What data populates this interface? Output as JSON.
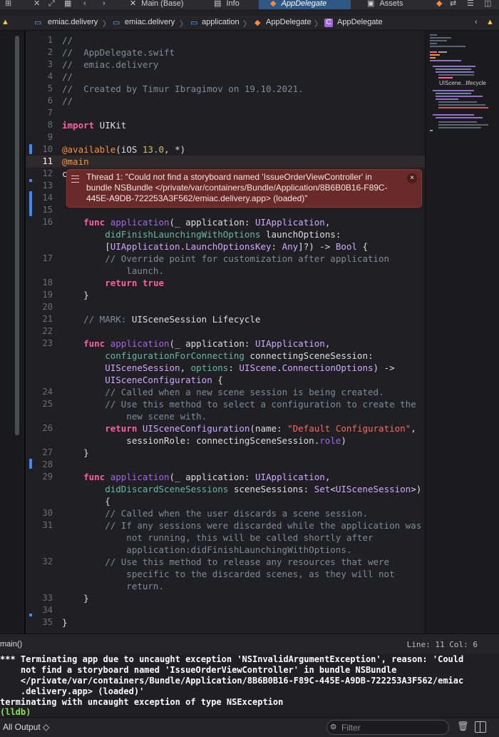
{
  "tabs": [
    {
      "label": "Main (Base)",
      "icon": "close-x-icon"
    },
    {
      "label": "Info",
      "icon": "table-icon"
    },
    {
      "label": "AppDelegate",
      "icon": "swift-icon",
      "active": true
    },
    {
      "label": "Assets",
      "icon": "image-icon"
    }
  ],
  "breadcrumb": [
    "emiac.delivery",
    "emiac.delivery",
    "application",
    "AppDelegate",
    "AppDelegate"
  ],
  "breadcrumb_class_badge": "C",
  "code": {
    "current_line": 11,
    "lines": [
      {
        "n": "1",
        "html": "<span class=\"cm\">//</span>"
      },
      {
        "n": "2",
        "html": "<span class=\"cm\">//  AppDelegate.swift</span>"
      },
      {
        "n": "3",
        "html": "<span class=\"cm\">//  emiac.delivery</span>"
      },
      {
        "n": "4",
        "html": "<span class=\"cm\">//</span>"
      },
      {
        "n": "5",
        "html": "<span class=\"cm\">//  Created by Timur Ibragimov on 19.10.2021.</span>"
      },
      {
        "n": "6",
        "html": "<span class=\"cm\">//</span>"
      },
      {
        "n": "7",
        "html": ""
      },
      {
        "n": "8",
        "html": "<span class=\"kw\">import</span> UIKit"
      },
      {
        "n": "9",
        "html": ""
      },
      {
        "n": "10",
        "html": "<span class=\"at\">@available</span>(iOS <span class=\"nm\">13.0</span>, *)"
      },
      {
        "n": "11",
        "html": "<span class=\"at\">@main</span>"
      },
      {
        "n": "12",
        "html": "c"
      },
      {
        "n": "13",
        "html": ""
      },
      {
        "n": "14",
        "html": ""
      },
      {
        "n": "15",
        "html": ""
      },
      {
        "n": "16",
        "html": "    <span class=\"kw\">func</span> <span class=\"fn\">application</span>(_ application: <span class=\"ty\">UIApplication</span>,\n        <span class=\"pl\">didFinishLaunchingWithOptions</span> launchOptions:\n        [<span class=\"ty\">UIApplication</span>.<span class=\"ty\">LaunchOptionsKey</span>: <span class=\"ty\">Any</span>]?) -> <span class=\"ty\">Bool</span> {"
      },
      {
        "n": "17",
        "html": "        <span class=\"cm\">// Override point for customization after application\n            launch.</span>"
      },
      {
        "n": "18",
        "html": "        <span class=\"kw\">return</span> <span class=\"kw\">true</span>"
      },
      {
        "n": "19",
        "html": "    }"
      },
      {
        "n": "20",
        "html": ""
      },
      {
        "n": "21",
        "html": "    <span class=\"cm\">// MARK: </span><span style=\"color:#dfdfe0\">UISceneSession Lifecycle</span>"
      },
      {
        "n": "22",
        "html": ""
      },
      {
        "n": "23",
        "html": "    <span class=\"kw\">func</span> <span class=\"fn\">application</span>(_ application: <span class=\"ty\">UIApplication</span>,\n        <span class=\"pl\">configurationForConnecting</span> connectingSceneSession:\n        <span class=\"ty\">UISceneSession</span>, <span class=\"pl\">options</span>: <span class=\"ty\">UIScene</span>.<span class=\"ty\">ConnectionOptions</span>) ->\n        <span class=\"ty\">UISceneConfiguration</span> {"
      },
      {
        "n": "24",
        "html": "        <span class=\"cm\">// Called when a new scene session is being created.</span>"
      },
      {
        "n": "25",
        "html": "        <span class=\"cm\">// Use this method to select a configuration to create the\n            new scene with.</span>"
      },
      {
        "n": "26",
        "html": "        <span class=\"kw\">return</span> <span class=\"ty\">UISceneConfiguration</span>(name: <span class=\"str\">\"Default Configuration\"</span>,\n            sessionRole: connectingSceneSession.<span class=\"fn\">role</span>)"
      },
      {
        "n": "27",
        "html": "    }"
      },
      {
        "n": "28",
        "html": ""
      },
      {
        "n": "29",
        "html": "    <span class=\"kw\">func</span> <span class=\"fn\">application</span>(_ application: <span class=\"ty\">UIApplication</span>,\n        <span class=\"pl\">didDiscardSceneSessions</span> sceneSessions: <span class=\"ty\">Set</span>&lt;<span class=\"ty\">UISceneSession</span>&gt;)\n        {"
      },
      {
        "n": "30",
        "html": "        <span class=\"cm\">// Called when the user discards a scene session.</span>"
      },
      {
        "n": "31",
        "html": "        <span class=\"cm\">// If any sessions were discarded while the application was\n            not running, this will be called shortly after\n            application:didFinishLaunchingWithOptions.</span>"
      },
      {
        "n": "32",
        "html": "        <span class=\"cm\">// Use this method to release any resources that were\n            specific to the discarded scenes, as they will not\n            return.</span>"
      },
      {
        "n": "33",
        "html": "    }"
      },
      {
        "n": "34",
        "html": ""
      },
      {
        "n": "35",
        "html": "}"
      }
    ]
  },
  "error_popup": {
    "text": "Thread 1: \"Could not find a storyboard named 'IssueOrderViewController' in bundle NSBundle </private/var/containers/Bundle/Application/8B6B0B16-F89C-445E-A9DB-722253A3F562/emiac.delivery.app> (loaded)\"",
    "close_glyph": "×"
  },
  "minimap": {
    "label": "UIScene...lifecycle"
  },
  "status": {
    "left": "main()",
    "right": "Line: 11  Col: 6"
  },
  "console": {
    "lines": [
      "*** Terminating app due to uncaught exception 'NSInvalidArgumentException', reason: 'Could",
      "    not find a storyboard named 'IssueOrderViewController' in bundle NSBundle",
      "    </private/var/containers/Bundle/Application/8B6B0B16-F89C-445E-A9DB-722253A3F562/emiac",
      "    .delivery.app> (loaded)'",
      "terminating with uncaught exception of type NSException",
      "(lldb)"
    ]
  },
  "bottom": {
    "output_selector": "All Output ◇",
    "filter_placeholder": "Filter"
  },
  "colors": {
    "accent": "#2f5887",
    "error_bg": "#6b2a2a",
    "keyword": "#fc5fa3",
    "lldb": "#8ee05c"
  }
}
